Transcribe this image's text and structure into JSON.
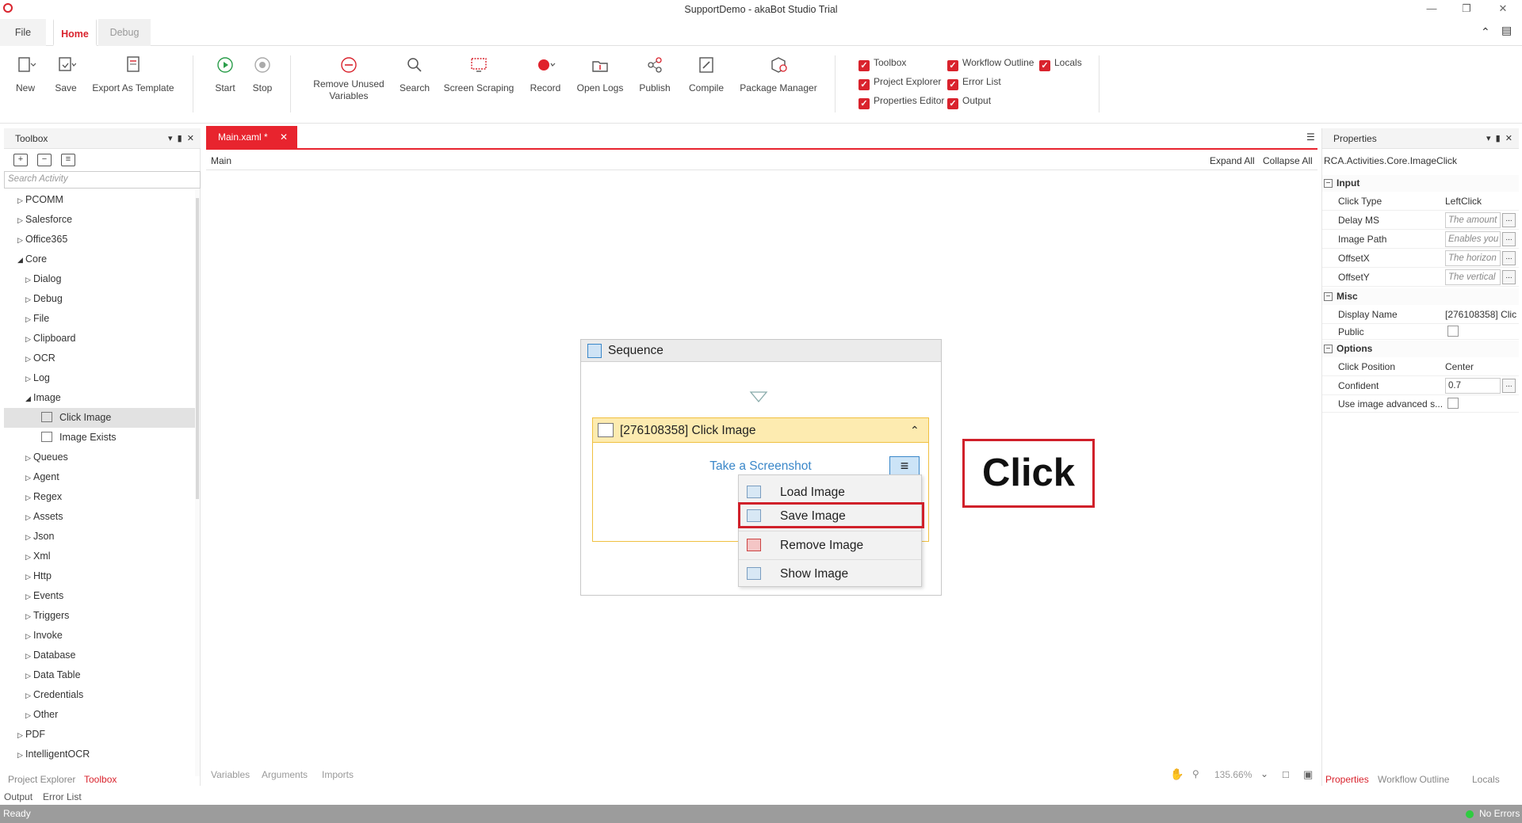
{
  "window": {
    "title": "SupportDemo - akaBot Studio Trial"
  },
  "menu_tabs": {
    "file": "File",
    "home": "Home",
    "debug": "Debug"
  },
  "ribbon": {
    "new": "New",
    "save": "Save",
    "export_template": "Export As Template",
    "start": "Start",
    "stop": "Stop",
    "remove_unused_1": "Remove Unused",
    "remove_unused_2": "Variables",
    "search": "Search",
    "screen_scraping": "Screen Scraping",
    "record": "Record",
    "open_logs": "Open Logs",
    "publish": "Publish",
    "compile": "Compile",
    "package_manager": "Package Manager",
    "checks": {
      "toolbox": "Toolbox",
      "project_explorer": "Project Explorer",
      "properties_editor": "Properties Editor",
      "workflow_outline": "Workflow Outline",
      "error_list": "Error List",
      "output": "Output",
      "locals": "Locals"
    }
  },
  "toolbox": {
    "title": "Toolbox",
    "search_placeholder": "Search Activity",
    "tree": [
      {
        "label": "PCOMM",
        "state": "collapsed",
        "level": 1
      },
      {
        "label": "Salesforce",
        "state": "collapsed",
        "level": 1
      },
      {
        "label": "Office365",
        "state": "collapsed",
        "level": 1
      },
      {
        "label": "Core",
        "state": "expanded",
        "level": 1
      },
      {
        "label": "Dialog",
        "state": "collapsed",
        "level": 2
      },
      {
        "label": "Debug",
        "state": "collapsed",
        "level": 2
      },
      {
        "label": "File",
        "state": "collapsed",
        "level": 2
      },
      {
        "label": "Clipboard",
        "state": "collapsed",
        "level": 2
      },
      {
        "label": "OCR",
        "state": "collapsed",
        "level": 2
      },
      {
        "label": "Log",
        "state": "collapsed",
        "level": 2
      },
      {
        "label": "Image",
        "state": "expanded",
        "level": 2
      },
      {
        "label": "Click Image",
        "state": "leaf",
        "level": 3,
        "selected": true
      },
      {
        "label": "Image Exists",
        "state": "leaf",
        "level": 3
      },
      {
        "label": "Queues",
        "state": "collapsed",
        "level": 2
      },
      {
        "label": "Agent",
        "state": "collapsed",
        "level": 2
      },
      {
        "label": "Regex",
        "state": "collapsed",
        "level": 2
      },
      {
        "label": "Assets",
        "state": "collapsed",
        "level": 2
      },
      {
        "label": "Json",
        "state": "collapsed",
        "level": 2
      },
      {
        "label": "Xml",
        "state": "collapsed",
        "level": 2
      },
      {
        "label": "Http",
        "state": "collapsed",
        "level": 2
      },
      {
        "label": "Events",
        "state": "collapsed",
        "level": 2
      },
      {
        "label": "Triggers",
        "state": "collapsed",
        "level": 2
      },
      {
        "label": "Invoke",
        "state": "collapsed",
        "level": 2
      },
      {
        "label": "Database",
        "state": "collapsed",
        "level": 2
      },
      {
        "label": "Data Table",
        "state": "collapsed",
        "level": 2
      },
      {
        "label": "Credentials",
        "state": "collapsed",
        "level": 2
      },
      {
        "label": "Other",
        "state": "collapsed",
        "level": 2
      },
      {
        "label": "PDF",
        "state": "collapsed",
        "level": 1
      },
      {
        "label": "IntelligentOCR",
        "state": "collapsed",
        "level": 1
      }
    ],
    "bottom_tabs": {
      "project_explorer": "Project Explorer",
      "toolbox": "Toolbox"
    },
    "bottom_tabs2": {
      "output": "Output",
      "error_list": "Error List"
    }
  },
  "editor": {
    "doc_tab": "Main.xaml *",
    "breadcrumb": "Main",
    "expand_all": "Expand All",
    "collapse_all": "Collapse All",
    "sequence_title": "Sequence",
    "activity_title": "[276108358] Click Image",
    "screenshot_link": "Take a Screenshot",
    "context_menu": [
      "Load Image",
      "Save Image",
      "Remove Image",
      "Show Image"
    ],
    "annotation": "Click",
    "bottom_tabs": {
      "variables": "Variables",
      "arguments": "Arguments",
      "imports": "Imports"
    },
    "zoom": "135.66%"
  },
  "properties": {
    "title": "Properties",
    "type_name": "RCA.Activities.Core.ImageClick",
    "categories": {
      "input": "Input",
      "misc": "Misc",
      "options": "Options"
    },
    "input": {
      "click_type": {
        "name": "Click Type",
        "value": "LeftClick"
      },
      "delay_ms": {
        "name": "Delay MS",
        "placeholder": "The amount"
      },
      "image_path": {
        "name": "Image Path",
        "placeholder": "Enables you"
      },
      "offset_x": {
        "name": "OffsetX",
        "placeholder": "The horizon"
      },
      "offset_y": {
        "name": "OffsetY",
        "placeholder": "The vertical"
      }
    },
    "misc": {
      "display_name": {
        "name": "Display Name",
        "value": "[276108358] Clic"
      },
      "public": {
        "name": "Public"
      }
    },
    "options": {
      "click_position": {
        "name": "Click Position",
        "value": "Center"
      },
      "confident": {
        "name": "Confident",
        "value": "0.7"
      },
      "use_advanced": {
        "name": "Use image advanced s..."
      }
    },
    "bottom_tabs": {
      "properties": "Properties",
      "workflow_outline": "Workflow Outline",
      "locals": "Locals"
    }
  },
  "status": {
    "left": "Ready",
    "right": "No Errors"
  },
  "colors": {
    "accent": "#d9232d",
    "status_ok": "#2ecc40"
  }
}
